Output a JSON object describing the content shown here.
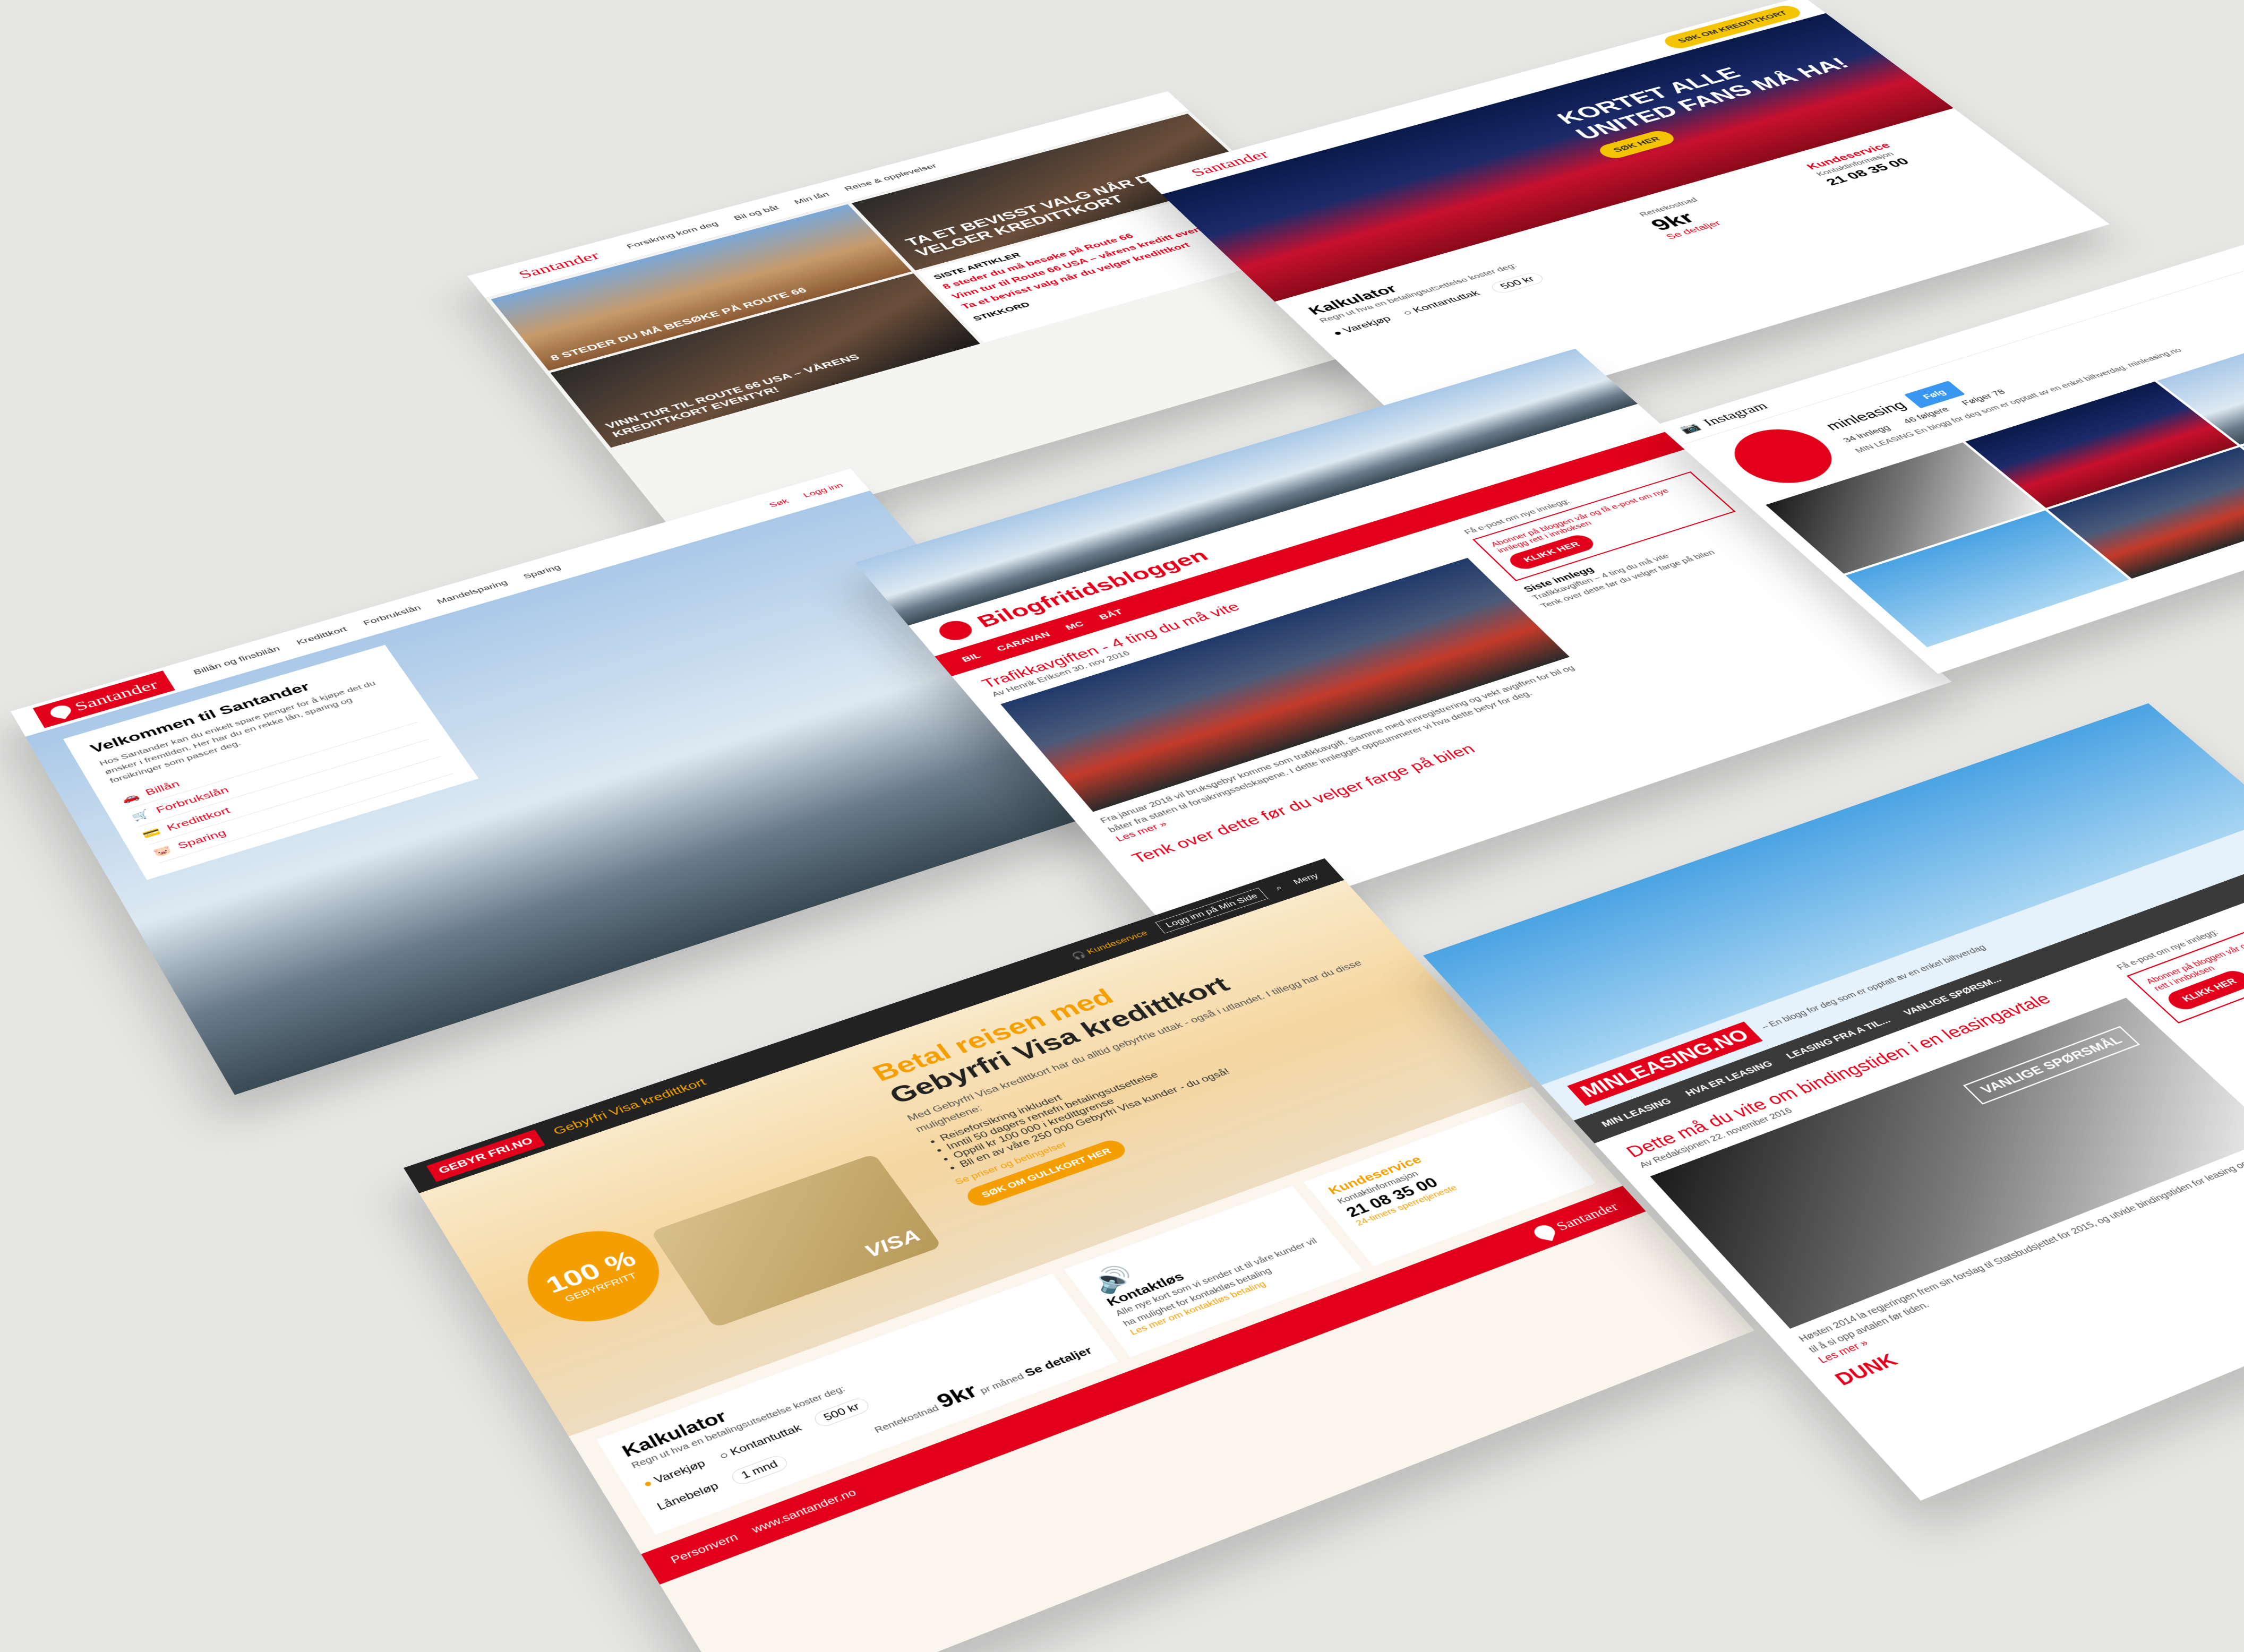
{
  "cards": {
    "magazine": {
      "brand": "Santander",
      "nav": [
        "Forsikring kom deg",
        "Bil og båt",
        "Min lån",
        "Reise & opplevelser"
      ],
      "hero_headline": "TA ET BEVISST VALG NÅR DU VELGER KREDITTKORT",
      "tile1": "8 STEDER DU MÅ BESØKE PÅ ROUTE 66",
      "tile2": "VINN TUR TIL ROUTE 66 USA – VÅRENS KREDITTKORT EVENTYR!",
      "article1": "8 steder du må besøke på Route 66",
      "article2": "Vinn tur til Route 66 USA – vårens kreditt eventyr!",
      "article3": "Ta et bevisst valg når du velger kredittkort",
      "sidebar_title": "SISTE ARTIKLER",
      "tags_title": "STIKKORD"
    },
    "manutd": {
      "brand": "Santander",
      "cta_top": "SØK OM KREDITTKORT",
      "headline1": "KORTET ALLE",
      "headline2": "UNITED FANS MÅ HA!",
      "cta_btn": "SØK HER",
      "calc_title": "Kalkulator",
      "calc_sub": "Regn ut hva en betalingsutsettelse koster deg:",
      "opt1": "Varekjøp",
      "opt2": "Kontantuttak",
      "amount": "500 kr",
      "cost_label": "Rentekostnad",
      "cost": "9kr",
      "details": "Se detaljer",
      "service_title": "Kundeservice",
      "service_sub": "Kontaktinformasjon",
      "phone": "21 08 35 00"
    },
    "santander_home": {
      "brand": "Santander",
      "nav": [
        "Billån og finsbilån",
        "Kredittkort",
        "Forbrukslån",
        "Mandelsparing",
        "Sparing"
      ],
      "nav_right": [
        "Søk",
        "Logg inn"
      ],
      "welcome_title": "Velkommen til Santander",
      "welcome_text": "Hos Santander kan du enkelt spare penger for å kjøpe det du ønsker i fremtiden. Her har du en rekke lån, sparing og forsikringer som passer deg.",
      "products": [
        "Billån",
        "Forbrukslån",
        "Kredittkort",
        "Sparing"
      ]
    },
    "blog": {
      "title": "Bilogfritidsbloggen",
      "nav": [
        "BIL",
        "CARAVAN",
        "MC",
        "BÅT"
      ],
      "post_title": "Trafikkavgiften - 4 ting du må vite",
      "post_meta": "Av Henrik Eriksen 30. nov 2016",
      "post_text": "Fra januar 2018 vil bruksgebyr komme som trafikkavgift. Samme med innregistrering og vekt avgiften for bil og båter fra staten til forsikringsselskapene. I dette innlegget oppsummerer vi hva dette betyr for deg.",
      "read_more": "Les mer »",
      "next_title": "Tenk over dette før du velger farge på bilen",
      "subscribe": "Få e-post om nye innlegg:",
      "subscribe_box": "Abonner på bloggen vår og få e-post om nye innlegg rett i innboksen",
      "click": "KLIKK HER",
      "latest": "Siste innlegg",
      "latest1": "Trafikkavgiften – 4 ting du må vite",
      "latest2": "Tenk over dette før du velger farge på bilen"
    },
    "instagram": {
      "app": "Instagram",
      "user": "minleasing",
      "follow": "Følg",
      "stats": [
        "34 innlegg",
        "46 følgere",
        "Følger 78"
      ],
      "bio": "MIN LEASING En blogg for deg som er opptatt av en enkel bilhverdag. minleasing.no"
    },
    "gebyrfri": {
      "badge": "GEBYR FRI.NO",
      "product": "Gebyrfri Visa kredittkort",
      "menu": "Meny",
      "login": "Logg inn på Min Side",
      "service": "Kundeservice",
      "headline1": "Betal reisen med",
      "headline2": "Gebyrfri Visa kredittkort",
      "intro": "Med Gebyrfri Visa kredittkort har du alltid gebyrfrie uttak - også i utlandet. I tillegg har du disse mulighetene:",
      "bullets": [
        "Reiseforsikring inkludert",
        "Inntil 50 dagers rentefri betalingsutsettelse",
        "Opptil kr 100 000 i kredittgrense",
        "Bli en av våre 250 000 Gebyrfri Visa kunder - du også!"
      ],
      "conditions": "Se priser og betingelser",
      "cta": "SØK OM GULLKORT HER",
      "percent": "100 %",
      "percent_sub": "GEBYRFRITT",
      "card_brand": "VISA",
      "calc_title": "Kalkulator",
      "calc_sub": "Regn ut hva en betalingsutsettelse koster deg:",
      "opt1": "Varekjøp",
      "opt2": "Kontantuttak",
      "amount_label": "Lånebeløp",
      "amount": "500 kr",
      "period": "1 mnd",
      "cost_label": "Rentekostnad",
      "cost": "9kr",
      "per_month": "pr måned",
      "details": "Se detaljer",
      "contactless_title": "Kontaktløs",
      "contactless_text": "Alle nye kort som vi sender ut til våre kunder vil ha mulighet for kontaktløs betaling",
      "contactless_link": "Les mer om kontaktløs betaling",
      "service_title": "Kundeservice",
      "service_sub": "Kontaktinformasjon",
      "phone": "21 08 35 00",
      "service_link": "24-timers sperretjeneste",
      "footer_brand": "Santander",
      "footer_site": "www.santander.no",
      "footer_privacy": "Personvern"
    },
    "minleasing": {
      "logo": "MINLEASING.NO",
      "tagline": "– En blogg for deg som er opptatt av en enkel bilhverdag",
      "nav": [
        "MIN LEASING",
        "HVA ER LEASING",
        "LEASING FRA A TIL...",
        "VANLIGE SPØRSM..."
      ],
      "post_title": "Dette må du vite om bindingstiden i en leasingavtale",
      "post_meta": "Av Redaksjonen 22. november 2016",
      "badge": "VANLIGE SPØRSMÅL",
      "post_text": "Høsten 2014 la regjeringen frem sin forslag til Statsbudsjettet for 2015, og utvide bindingstiden for leasing og deres rett til å si opp avtalen før tiden.",
      "read_more": "Les mer »",
      "next": "DUNK",
      "subscribe": "Få e-post om nye innlegg:",
      "subscribe_box": "Abonner på bloggen vår og få e-post om nye innlegg rett i innboksen",
      "click": "KLIKK HER"
    }
  }
}
